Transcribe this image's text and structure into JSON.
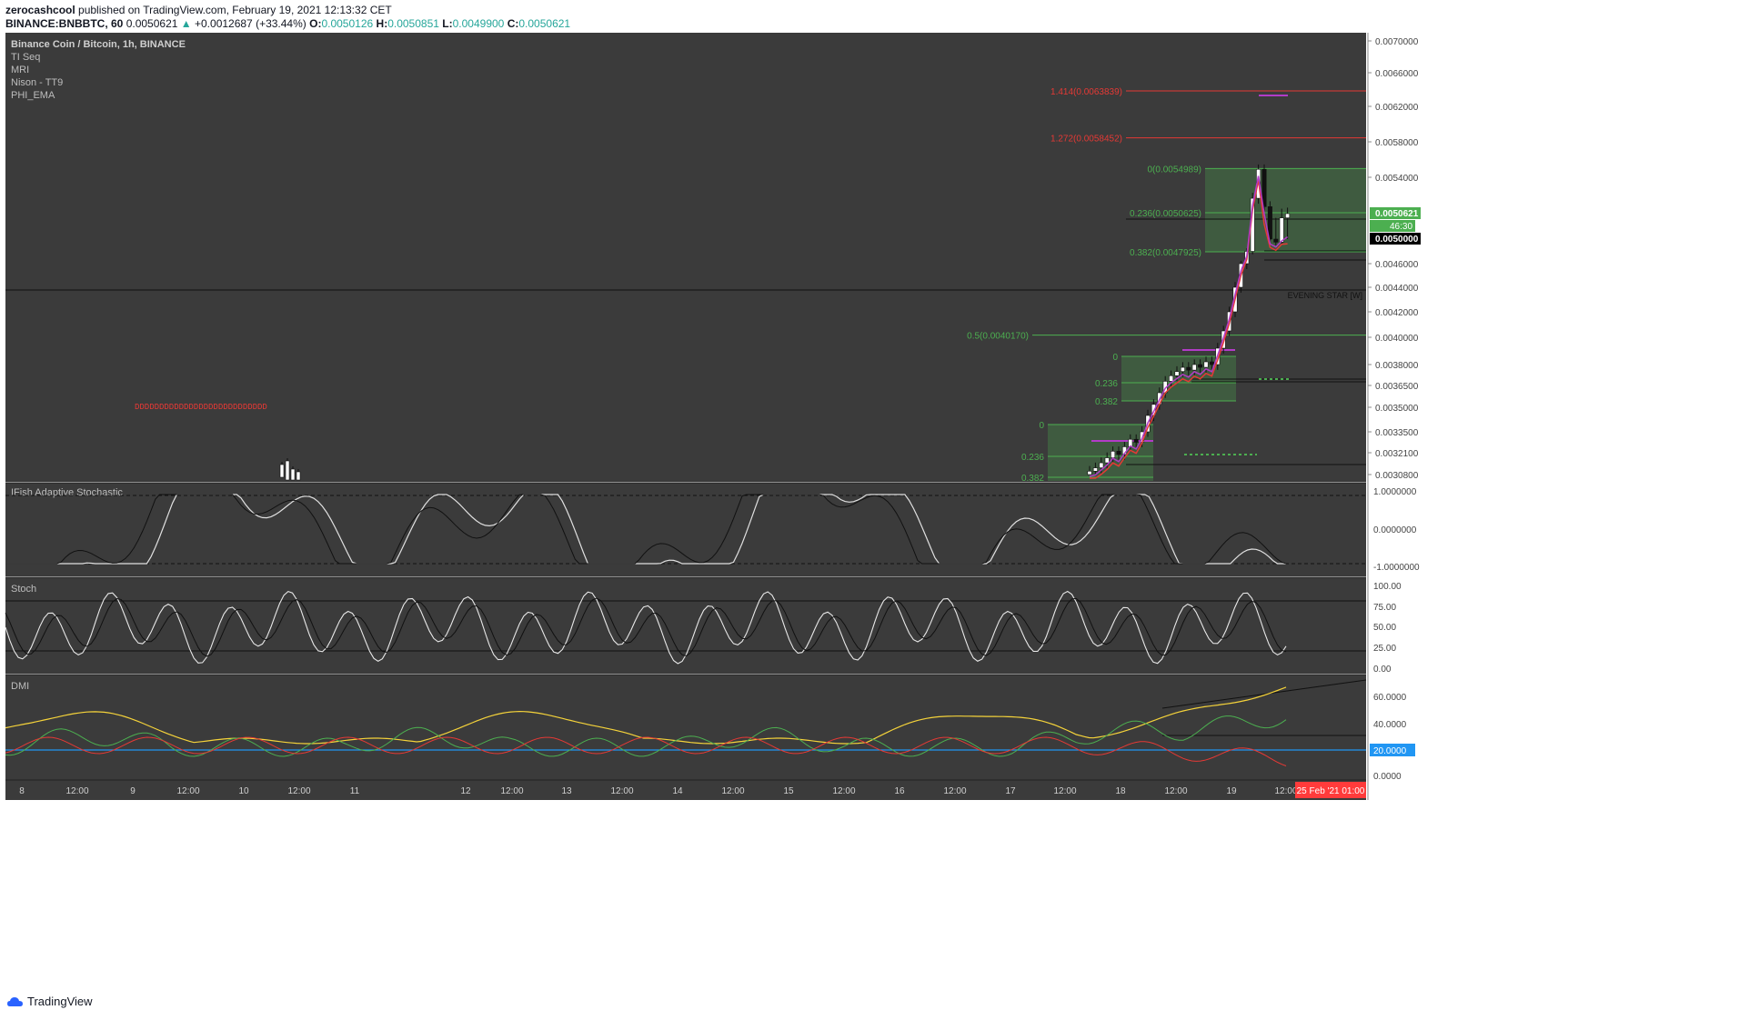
{
  "header": {
    "line1_user": "zerocashcool",
    "line1_rest": " published on TradingView.com, February 19, 2021 12:13:32 CET",
    "symbol": "BINANCE:BNBBTC, 60",
    "last": "0.0050621",
    "change_arrow": "▲",
    "change": "+0.0012687 (+33.44%)",
    "o_label": "O:",
    "o": "0.0050126",
    "h_label": "H:",
    "h": "0.0050851",
    "l_label": "L:",
    "l": "0.0049900",
    "c_label": "C:",
    "c": "0.0050621"
  },
  "legend": [
    "Binance Coin / Bitcoin, 1h, BINANCE",
    "TI Seq",
    "MRI",
    "Nison - TT9",
    "PHI_EMA"
  ],
  "footer_brand": "TradingView",
  "colors": {
    "bg": "#3b3b3b",
    "grid": "#4a4a4a",
    "green": "#4caf50",
    "red": "#e53935",
    "yellow": "#f5d33a",
    "blue": "#2196f3",
    "white": "#ffffff",
    "purple": "#b23cc7"
  },
  "chart_data": {
    "type": "candlestick",
    "panes": [
      {
        "name": "price",
        "symbol": "Binance Coin / Bitcoin, 1h, BINANCE",
        "y_ticks": [
          "0.0070000",
          "0.0066000",
          "0.0062000",
          "0.0058000",
          "0.0054000",
          "0.0050621",
          "0.0050000",
          "0.0046000",
          "0.0044000",
          "0.0042000",
          "0.0040000",
          "0.0038000",
          "0.0036500",
          "0.0035000",
          "0.0033500",
          "0.0032100",
          "0.0030800"
        ],
        "last_price_label": "0.0050621",
        "countdown_label": "46:30",
        "line_price_label": "0.0050000",
        "fib_levels_upper": [
          {
            "label": "1.414(0.0063839)",
            "value": 0.0063839,
            "color": "red"
          },
          {
            "label": "1.272(0.0058452)",
            "value": 0.0058452,
            "color": "red"
          },
          {
            "label": "0(0.0054989)",
            "value": 0.0054989,
            "color": "green"
          },
          {
            "label": "0.236(0.0050625)",
            "value": 0.0050625,
            "color": "green"
          },
          {
            "label": "0.382(0.0047925)",
            "value": 0.0047925,
            "color": "green"
          },
          {
            "label": "0.5(0.0040170)",
            "value": 0.004017,
            "color": "green"
          }
        ],
        "fib_levels_mid": [
          "0",
          "0.236",
          "0.382"
        ],
        "fib_levels_low": [
          "0",
          "0.236",
          "0.382"
        ],
        "pattern_label": "EVENING STAR [W]",
        "marker_text": "DDDDDDDDDDDDDDDDDDDDDDDDDDD",
        "close_values": [
          0.0031,
          0.00312,
          0.00315,
          0.00318,
          0.00322,
          0.0032,
          0.00325,
          0.0033,
          0.00328,
          0.00335,
          0.00345,
          0.00352,
          0.0036,
          0.00368,
          0.00372,
          0.00375,
          0.00378,
          0.00376,
          0.0038,
          0.00378,
          0.00382,
          0.0038,
          0.00392,
          0.00405,
          0.0042,
          0.0044,
          0.0046,
          0.0048,
          0.0052,
          0.00549,
          0.00512,
          0.005,
          0.00495,
          0.00505,
          0.00506
        ]
      },
      {
        "name": "IFish Adaptive Stochastic",
        "y_ticks": [
          "1.0000000",
          "0.0000000",
          "-1.0000000"
        ]
      },
      {
        "name": "Stoch",
        "y_ticks": [
          "100.00",
          "75.00",
          "50.00",
          "25.00",
          "0.00"
        ]
      },
      {
        "name": "DMI",
        "y_ticks": [
          "60.0000",
          "40.0000",
          "20.0000",
          "0.0000"
        ],
        "highlight_label": "20.0000"
      }
    ],
    "x_ticks": [
      "8",
      "12:00",
      "9",
      "12:00",
      "10",
      "12:00",
      "11",
      "12",
      "12:00",
      "13",
      "12:00",
      "14",
      "12:00",
      "15",
      "12:00",
      "16",
      "12:00",
      "17",
      "12:00",
      "18",
      "12:00",
      "19",
      "12:00"
    ],
    "x_crosshair_label": "25 Feb '21   01:00"
  }
}
